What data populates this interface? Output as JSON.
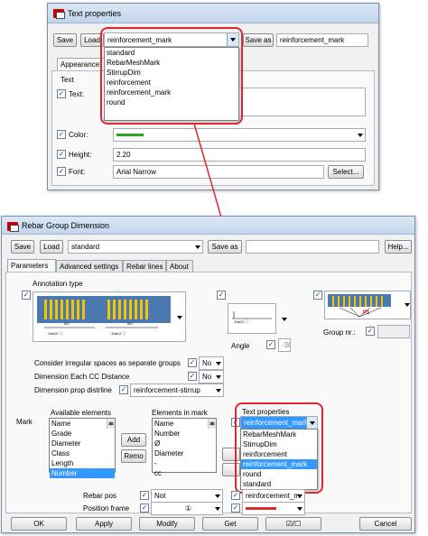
{
  "top_window": {
    "title": "Text properties",
    "save_label": "Save",
    "load_label": "Load",
    "dropdown_value": "reinforcement_mark",
    "save_as_label": "Save as",
    "save_as_value": "reinforcement_mark",
    "tab_appearance": "Appearance",
    "group_text": "Text",
    "text_label": "Text:",
    "color_label": "Color:",
    "height_label": "Height:",
    "height_value": "2.20",
    "font_label": "Font:",
    "font_value": "Arial Narrow",
    "select_label": "Select...",
    "dropdown_options": [
      "standard",
      "RebarMeshMark",
      "StirrupDim",
      "reinforcement",
      "reinforcement_mark",
      "round"
    ],
    "color_swatch": "#22aa22"
  },
  "main_window": {
    "title": "Rebar Group Dimension",
    "save_label": "Save",
    "load_label": "Load",
    "preset_value": "standard",
    "save_as_label": "Save as",
    "save_as_value": "",
    "help_label": "Help...",
    "tabs": [
      "Parameters",
      "Advanced settings",
      "Rebar lines",
      "About"
    ],
    "annotation_type_label": "Annotation type",
    "angle_label": "Angle",
    "angle_value": "-30",
    "group_nr_label": "Group nr.:",
    "group_nr_value": "",
    "p1_label": "P1",
    "irregular_label": "Consider irregular spaces as separate groups",
    "irregular_value": "No",
    "dim_each_cc_label": "Dimension Each CC Distance",
    "dim_each_cc_value": "No",
    "dim_prop_label": "Dimension prop distrline",
    "dim_prop_value": "reinforcement-stirrup",
    "mark_label": "Mark",
    "available_label": "Available elements",
    "available_items": [
      "Name",
      "Grade",
      "Diameter",
      "Class",
      "Length",
      "Number"
    ],
    "elements_label": "Elements in mark",
    "elements_items": [
      "Name",
      "Number",
      "Ø",
      "Diameter",
      "-",
      "cc"
    ],
    "add_label": "Add",
    "remove_label": "Remo",
    "text_props_label": "Text properties",
    "text_props_value": "reinforcement_mark",
    "text_props_options": [
      "RebarMeshMark",
      "StirrupDim",
      "reinforcement",
      "reinforcement_mark",
      "round",
      "standard"
    ],
    "rebar_pos_label": "Rebar pos",
    "rebar_pos_value": "Not",
    "rebar_pos_text": "reinforcement_m",
    "position_frame_label": "Position frame",
    "position_frame_value": "①",
    "ok_label": "OK",
    "apply_label": "Apply",
    "modify_label": "Modify",
    "get_label": "Get",
    "toggle_label": "☑/☐",
    "cancel_label": "Cancel",
    "diagram_dim_left": "6/0",
    "diagram_sub_left": "10⌀12 ⓘ",
    "diagram_dim_right": "6/0",
    "diagram_sub_right": "10⌀12 ⓘ",
    "angle_diagram_text": "10⌀12 ⓘ"
  }
}
